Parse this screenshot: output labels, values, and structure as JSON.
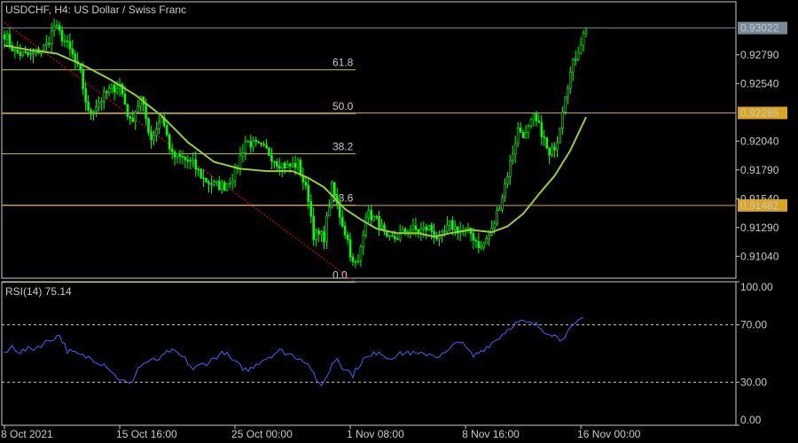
{
  "header": {
    "symbol": "USDCHF, H4:  US Dollar / Swiss Franc",
    "rsi_label": "RSI(14) 75.14"
  },
  "colors": {
    "background": "#000000",
    "frame": "#c8c8c8",
    "candle": "#00ff00",
    "ma": "#9acd32",
    "fib_level": "#c8c800",
    "fib_trend": "#ff0000",
    "rsi": "#3c64ff",
    "price_tag_current": "#778899",
    "price_tag_level": "#daa520",
    "text": "#c8c8c8"
  },
  "chart_data": [
    {
      "type": "candlestick",
      "title": "USDCHF, H4:  US Dollar / Swiss Franc",
      "ylim": [
        0.9085,
        0.9325
      ],
      "price_ticks": [
        "0.92790",
        "0.92540",
        "0.92040",
        "0.91790",
        "0.91540",
        "0.91290",
        "0.91040"
      ],
      "price_tick_values": [
        0.9279,
        0.9254,
        0.9204,
        0.9179,
        0.9154,
        0.9129,
        0.9104
      ],
      "price_tags": [
        {
          "label": "0.93022",
          "value": 0.93022,
          "kind": "current"
        },
        {
          "label": "0.92285",
          "value": 0.92285,
          "kind": "level"
        },
        {
          "label": "0.91482",
          "value": 0.91482,
          "kind": "level"
        }
      ],
      "time_labels": [
        "8 Oct 2021",
        "15 Oct 16:00",
        "25 Oct 00:00",
        "1 Nov 08:00",
        "8 Nov 16:00",
        "16 Nov 00:00"
      ],
      "time_label_index": [
        0,
        44,
        88,
        132,
        176,
        220
      ],
      "fibonacci": {
        "levels": [
          {
            "label": "61.8",
            "price": 0.9266
          },
          {
            "label": "50.0",
            "price": 0.9228
          },
          {
            "label": "38.2",
            "price": 0.9193
          },
          {
            "label": "23.6",
            "price": 0.91485
          },
          {
            "label": "0.0",
            "price": 0.90815
          }
        ],
        "trend_start": {
          "index": 0,
          "price": 0.9307
        },
        "trend_end": {
          "index": 134,
          "price": 0.90815
        }
      },
      "close_anchors": [
        [
          0,
          0.9297
        ],
        [
          4,
          0.9281
        ],
        [
          10,
          0.9278
        ],
        [
          16,
          0.9287
        ],
        [
          19,
          0.9304
        ],
        [
          23,
          0.9291
        ],
        [
          26,
          0.9278
        ],
        [
          29,
          0.9262
        ],
        [
          32,
          0.9228
        ],
        [
          36,
          0.9238
        ],
        [
          40,
          0.9248
        ],
        [
          44,
          0.9253
        ],
        [
          48,
          0.922
        ],
        [
          52,
          0.9241
        ],
        [
          56,
          0.9206
        ],
        [
          60,
          0.9226
        ],
        [
          64,
          0.9191
        ],
        [
          68,
          0.9189
        ],
        [
          72,
          0.9184
        ],
        [
          76,
          0.9171
        ],
        [
          80,
          0.9166
        ],
        [
          84,
          0.9165
        ],
        [
          88,
          0.9176
        ],
        [
          92,
          0.9204
        ],
        [
          96,
          0.92
        ],
        [
          100,
          0.9196
        ],
        [
          104,
          0.9186
        ],
        [
          108,
          0.9182
        ],
        [
          112,
          0.9184
        ],
        [
          116,
          0.9155
        ],
        [
          118,
          0.9123
        ],
        [
          122,
          0.9121
        ],
        [
          125,
          0.9164
        ],
        [
          128,
          0.914
        ],
        [
          131,
          0.9118
        ],
        [
          133,
          0.9097
        ],
        [
          135,
          0.9098
        ],
        [
          138,
          0.9141
        ],
        [
          140,
          0.9139
        ],
        [
          143,
          0.9133
        ],
        [
          146,
          0.9117
        ],
        [
          150,
          0.9121
        ],
        [
          154,
          0.9128
        ],
        [
          158,
          0.9126
        ],
        [
          162,
          0.9129
        ],
        [
          166,
          0.9118
        ],
        [
          170,
          0.9131
        ],
        [
          174,
          0.9126
        ],
        [
          178,
          0.9124
        ],
        [
          182,
          0.9111
        ],
        [
          186,
          0.9126
        ],
        [
          190,
          0.9157
        ],
        [
          193,
          0.9185
        ],
        [
          196,
          0.9214
        ],
        [
          199,
          0.9209
        ],
        [
          202,
          0.9224
        ],
        [
          205,
          0.9212
        ],
        [
          208,
          0.919
        ],
        [
          211,
          0.9206
        ],
        [
          214,
          0.9246
        ],
        [
          217,
          0.9271
        ],
        [
          220,
          0.929
        ],
        [
          222,
          0.9302
        ]
      ],
      "ma_anchors": [
        [
          0,
          0.9287
        ],
        [
          10,
          0.9283
        ],
        [
          20,
          0.928
        ],
        [
          30,
          0.927
        ],
        [
          40,
          0.9258
        ],
        [
          50,
          0.9244
        ],
        [
          60,
          0.9226
        ],
        [
          70,
          0.9203
        ],
        [
          80,
          0.9186
        ],
        [
          90,
          0.918
        ],
        [
          100,
          0.9178
        ],
        [
          110,
          0.9178
        ],
        [
          116,
          0.9172
        ],
        [
          122,
          0.9164
        ],
        [
          130,
          0.9145
        ],
        [
          136,
          0.9136
        ],
        [
          142,
          0.9128
        ],
        [
          150,
          0.9124
        ],
        [
          158,
          0.9124
        ],
        [
          164,
          0.9121
        ],
        [
          170,
          0.9124
        ],
        [
          178,
          0.9127
        ],
        [
          186,
          0.9125
        ],
        [
          192,
          0.913
        ],
        [
          198,
          0.9141
        ],
        [
          204,
          0.9158
        ],
        [
          210,
          0.9174
        ],
        [
          216,
          0.9196
        ],
        [
          222,
          0.9225
        ]
      ]
    },
    {
      "type": "line",
      "title": "RSI(14) 75.14",
      "series": [
        {
          "name": "RSI(14)",
          "last": 75.14
        }
      ],
      "ylim": [
        0,
        100
      ],
      "y_ticks": [
        "100.00",
        "70.00",
        "30.00",
        "0.00"
      ],
      "y_tick_values": [
        100,
        70,
        30,
        0
      ],
      "levels": [
        70,
        30
      ],
      "rsi_anchors": [
        [
          0,
          49
        ],
        [
          3,
          55
        ],
        [
          6,
          51
        ],
        [
          9,
          53
        ],
        [
          12,
          54
        ],
        [
          15,
          57
        ],
        [
          18,
          60
        ],
        [
          21,
          63
        ],
        [
          24,
          52
        ],
        [
          27,
          50
        ],
        [
          30,
          48
        ],
        [
          33,
          47
        ],
        [
          36,
          44
        ],
        [
          39,
          42
        ],
        [
          42,
          35
        ],
        [
          45,
          31
        ],
        [
          48,
          28
        ],
        [
          51,
          40
        ],
        [
          54,
          44
        ],
        [
          57,
          45
        ],
        [
          60,
          47
        ],
        [
          63,
          52
        ],
        [
          66,
          50
        ],
        [
          69,
          46
        ],
        [
          72,
          39
        ],
        [
          75,
          42
        ],
        [
          78,
          44
        ],
        [
          81,
          48
        ],
        [
          84,
          51
        ],
        [
          87,
          45
        ],
        [
          90,
          41
        ],
        [
          93,
          38
        ],
        [
          96,
          43
        ],
        [
          99,
          46
        ],
        [
          102,
          49
        ],
        [
          105,
          52
        ],
        [
          108,
          50
        ],
        [
          111,
          48
        ],
        [
          114,
          46
        ],
        [
          117,
          40
        ],
        [
          119,
          30
        ],
        [
          121,
          29
        ],
        [
          123,
          33
        ],
        [
          125,
          43
        ],
        [
          127,
          47
        ],
        [
          129,
          41
        ],
        [
          131,
          38
        ],
        [
          133,
          35
        ],
        [
          135,
          41
        ],
        [
          137,
          46
        ],
        [
          140,
          48
        ],
        [
          143,
          52
        ],
        [
          146,
          47
        ],
        [
          150,
          49
        ],
        [
          154,
          51
        ],
        [
          158,
          49
        ],
        [
          162,
          50
        ],
        [
          166,
          48
        ],
        [
          170,
          52
        ],
        [
          173,
          60
        ],
        [
          176,
          54
        ],
        [
          179,
          48
        ],
        [
          182,
          52
        ],
        [
          185,
          56
        ],
        [
          188,
          60
        ],
        [
          191,
          65
        ],
        [
          194,
          70
        ],
        [
          197,
          72
        ],
        [
          200,
          71
        ],
        [
          203,
          70
        ],
        [
          206,
          66
        ],
        [
          209,
          64
        ],
        [
          212,
          60
        ],
        [
          215,
          65
        ],
        [
          218,
          70
        ],
        [
          221,
          75
        ]
      ]
    }
  ]
}
